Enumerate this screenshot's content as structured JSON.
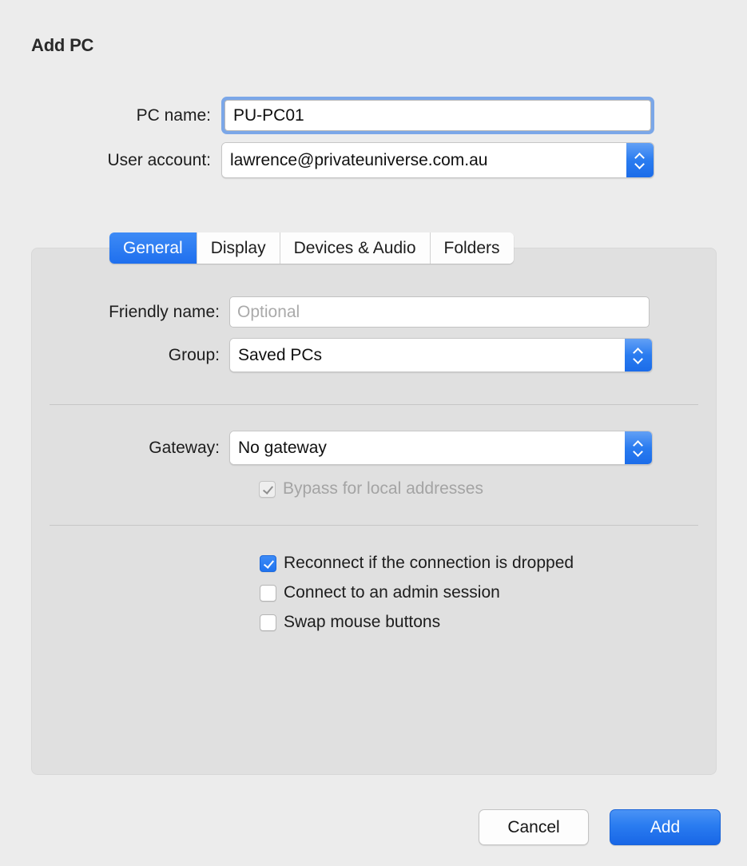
{
  "dialog": {
    "title": "Add PC"
  },
  "top_form": {
    "pc_name": {
      "label": "PC name:",
      "value": "PU-PC01"
    },
    "user_account": {
      "label": "User account:",
      "value": "lawrence@privateuniverse.com.au"
    }
  },
  "tabs": [
    {
      "label": "General",
      "selected": true
    },
    {
      "label": "Display",
      "selected": false
    },
    {
      "label": "Devices & Audio",
      "selected": false
    },
    {
      "label": "Folders",
      "selected": false
    }
  ],
  "general_panel": {
    "friendly_name": {
      "label": "Friendly name:",
      "value": "",
      "placeholder": "Optional"
    },
    "group": {
      "label": "Group:",
      "value": "Saved PCs"
    },
    "gateway": {
      "label": "Gateway:",
      "value": "No gateway"
    },
    "bypass": {
      "label": "Bypass for local addresses",
      "checked": true,
      "enabled": false
    },
    "options": [
      {
        "label": "Reconnect if the connection is dropped",
        "checked": true
      },
      {
        "label": "Connect to an admin session",
        "checked": false
      },
      {
        "label": "Swap mouse buttons",
        "checked": false
      }
    ]
  },
  "footer": {
    "cancel_label": "Cancel",
    "add_label": "Add"
  },
  "colors": {
    "accent_blue": "#2a7cf0",
    "focus_ring": "#7ba7e8",
    "dialog_bg": "#ececec",
    "panel_bg": "#e0e0e0",
    "disabled_text": "#a4a4a4"
  }
}
